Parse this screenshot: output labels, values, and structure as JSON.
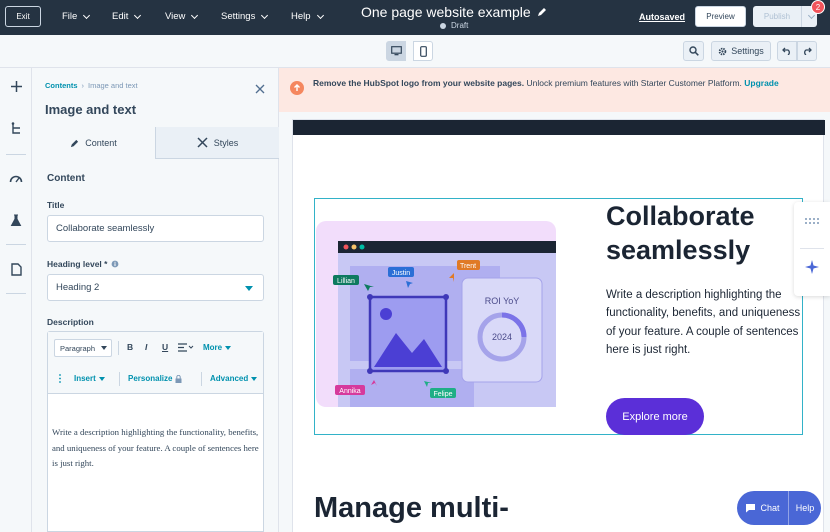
{
  "topbar": {
    "exit_label": "Exit",
    "menus": [
      "File",
      "Edit",
      "View",
      "Settings",
      "Help"
    ],
    "page_title": "One page website example",
    "status": "Draft",
    "autosaved": "Autosaved",
    "preview_label": "Preview",
    "publish_label": "Publish",
    "notification_count": "2"
  },
  "toolbar": {
    "settings_label": "Settings"
  },
  "panel": {
    "breadcrumb_root": "Contents",
    "breadcrumb_current": "Image and text",
    "title": "Image and text",
    "tabs": [
      "Content",
      "Styles"
    ],
    "section_heading": "Content",
    "title_field": {
      "label": "Title",
      "value": "Collaborate seamlessly"
    },
    "heading_level": {
      "label": "Heading level *",
      "value": "Heading 2"
    },
    "description": {
      "label": "Description",
      "paragraph_select": "Paragraph",
      "bold": "B",
      "italic": "I",
      "underline": "U",
      "more": "More",
      "insert": "Insert",
      "personalize": "Personalize",
      "advanced": "Advanced",
      "text": "Write a description highlighting the functionality, benefits, and uniqueness of your feature. A couple of sentences here is just right."
    }
  },
  "canvas": {
    "banner_bold": "Remove the HubSpot logo from your website pages.",
    "banner_text": " Unlock premium features with Starter Customer Platform. ",
    "banner_link": "Upgrade",
    "module_title": "Collaborate seamlessly",
    "module_description": "Write a description highlighting the functionality, benefits, and uniqueness of your feature. A couple of sentences here is just right.",
    "cta_label": "Explore more",
    "next_heading": "Manage multi-",
    "illustration": {
      "names": [
        "Lillian",
        "Justin",
        "Trent",
        "Annika",
        "Felipe"
      ],
      "card_title": "ROI YoY",
      "card_year": "2024"
    },
    "chat_label": "Chat",
    "help_label": "Help"
  },
  "colors": {
    "topbar": "#253342",
    "accent": "#0091ae",
    "cta": "#5b2fd8",
    "banner": "#fde8e2",
    "selection": "#32b2c8"
  }
}
